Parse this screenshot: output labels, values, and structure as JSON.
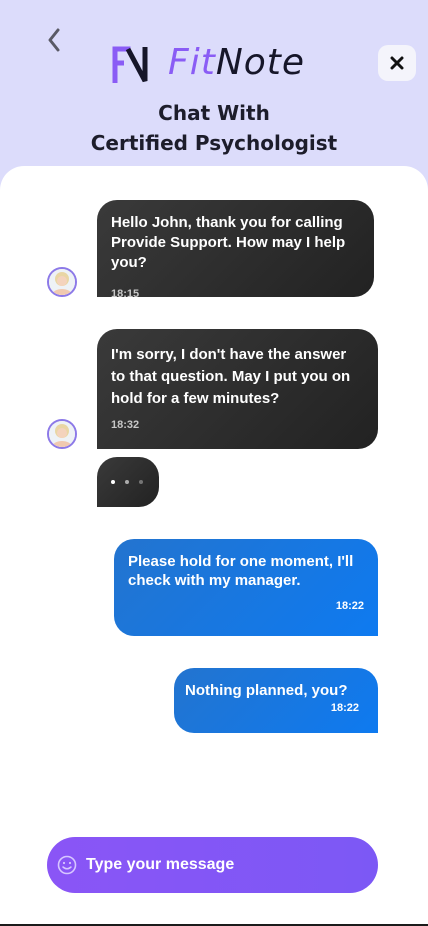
{
  "header": {
    "logo_fit": "Fit",
    "logo_note": "Note",
    "title_line1": "Chat With",
    "title_line2": "Certified Psychologist",
    "back_icon": "chevron-left-icon",
    "close_icon": "close-icon"
  },
  "messages": [
    {
      "direction": "incoming",
      "text": "Hello John, thank you for calling Provide Support. How may I help you?",
      "time": "18:15"
    },
    {
      "direction": "incoming",
      "text": "I'm sorry, I don't have the answer to that question. May I put you on hold for a few minutes?",
      "time": "18:32"
    },
    {
      "direction": "outgoing",
      "text": "Please hold for one moment, I'll check with my manager.",
      "time": "18:22"
    },
    {
      "direction": "outgoing",
      "text": "Nothing planned, you?",
      "time": "18:22"
    }
  ],
  "composer": {
    "placeholder": "Type your message",
    "emoji_icon": "smiley-icon"
  },
  "colors": {
    "header_bg": "#dcdcfb",
    "brand_purple": "#8a5cf5",
    "incoming_bubble": "#2a2a2a",
    "outgoing_bubble": "#0e7af0",
    "composer_bg": "#8a55f6"
  }
}
